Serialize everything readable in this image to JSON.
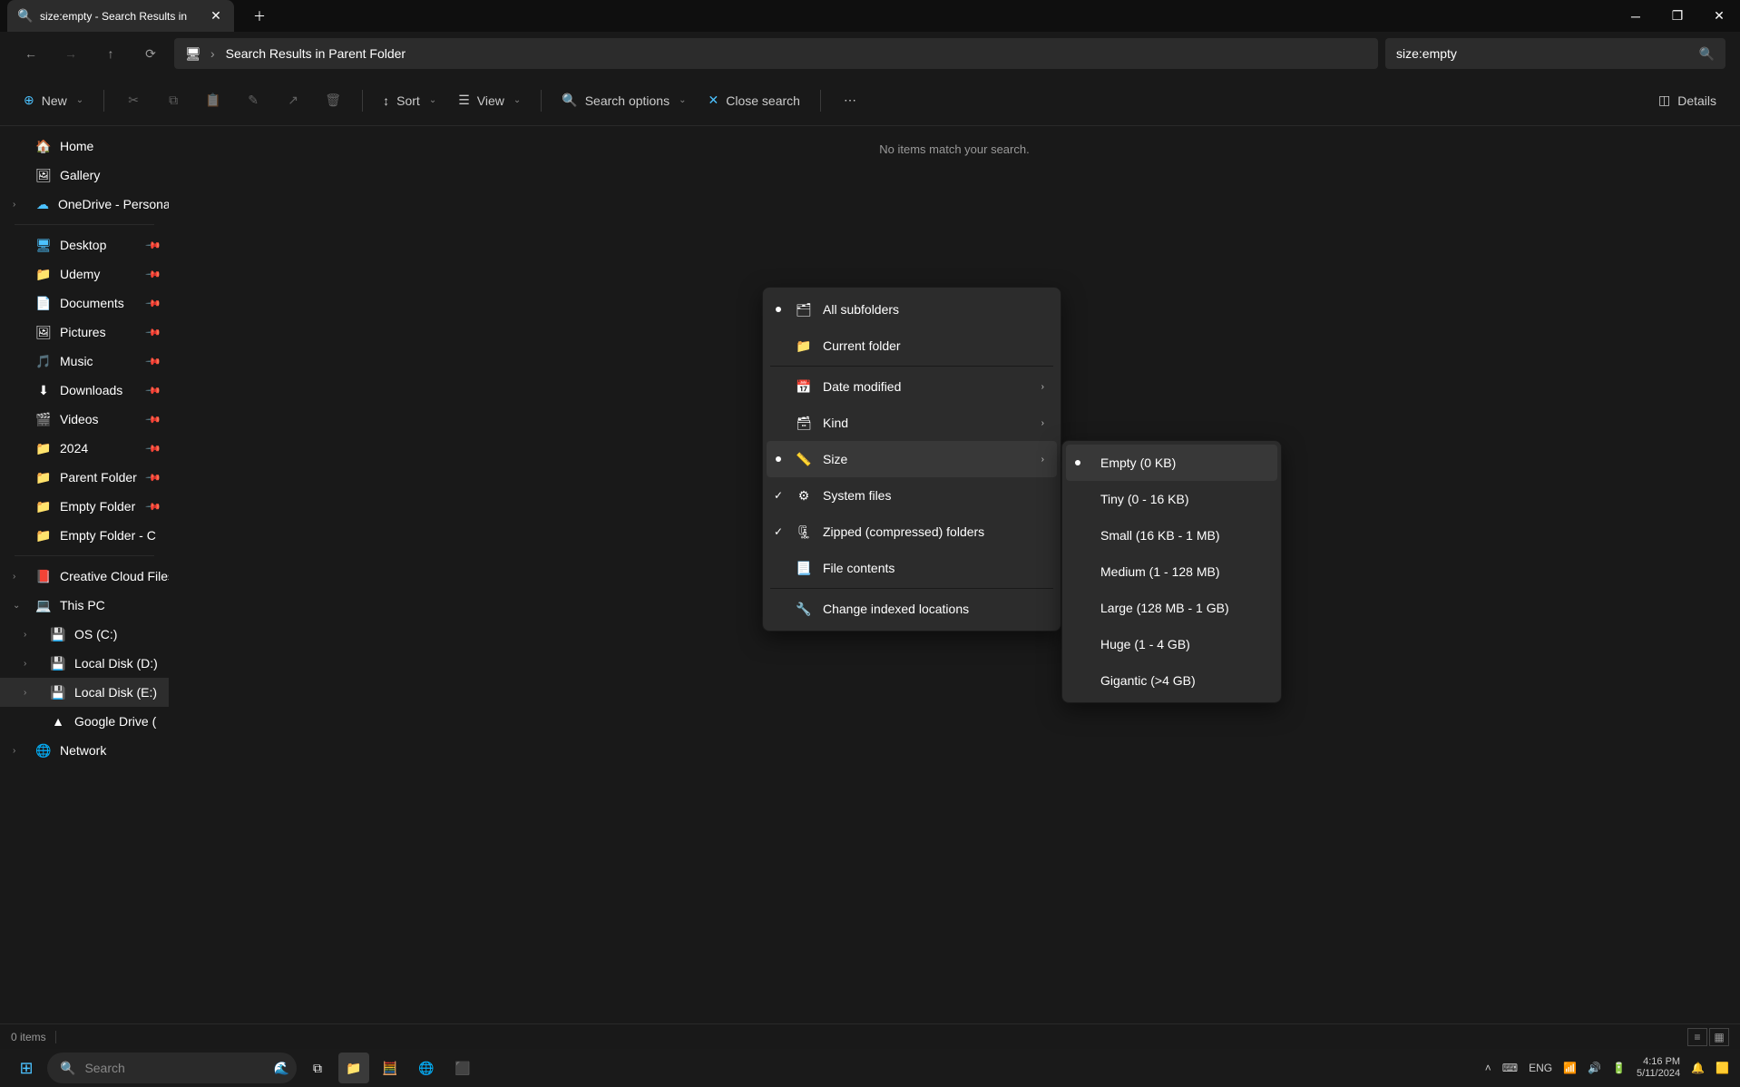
{
  "titlebar": {
    "tab_title": "size:empty - Search Results in"
  },
  "nav": {
    "address": "Search Results in Parent Folder",
    "search_value": "size:empty"
  },
  "toolbar": {
    "new": "New",
    "sort": "Sort",
    "view": "View",
    "search_options": "Search options",
    "close_search": "Close search",
    "details": "Details"
  },
  "sidebar": {
    "home": "Home",
    "gallery": "Gallery",
    "onedrive": "OneDrive - Personal",
    "desktop": "Desktop",
    "udemy": "Udemy",
    "documents": "Documents",
    "pictures": "Pictures",
    "music": "Music",
    "downloads": "Downloads",
    "videos": "Videos",
    "y2024": "2024",
    "parent": "Parent Folder",
    "empty": "Empty Folder",
    "emptyc": "Empty Folder - C",
    "ccf": "Creative Cloud Files",
    "thispc": "This PC",
    "osc": "OS (C:)",
    "ldd": "Local Disk (D:)",
    "lde": "Local Disk (E:)",
    "gdrive": "Google Drive (",
    "network": "Network"
  },
  "content": {
    "no_items": "No items match your search."
  },
  "menu_search": {
    "all_subfolders": "All subfolders",
    "current_folder": "Current folder",
    "date_modified": "Date modified",
    "kind": "Kind",
    "size": "Size",
    "system_files": "System files",
    "zipped": "Zipped (compressed) folders",
    "file_contents": "File contents",
    "change_indexed": "Change indexed locations"
  },
  "menu_size": {
    "empty": "Empty (0 KB)",
    "tiny": "Tiny (0 - 16 KB)",
    "small": "Small (16 KB - 1 MB)",
    "medium": "Medium (1 - 128 MB)",
    "large": "Large (128 MB - 1 GB)",
    "huge": "Huge (1 - 4 GB)",
    "gigantic": "Gigantic (>4 GB)"
  },
  "statusbar": {
    "count": "0 items"
  },
  "taskbar": {
    "search_placeholder": "Search",
    "lang": "ENG",
    "time": "4:16 PM",
    "date": "5/11/2024"
  }
}
